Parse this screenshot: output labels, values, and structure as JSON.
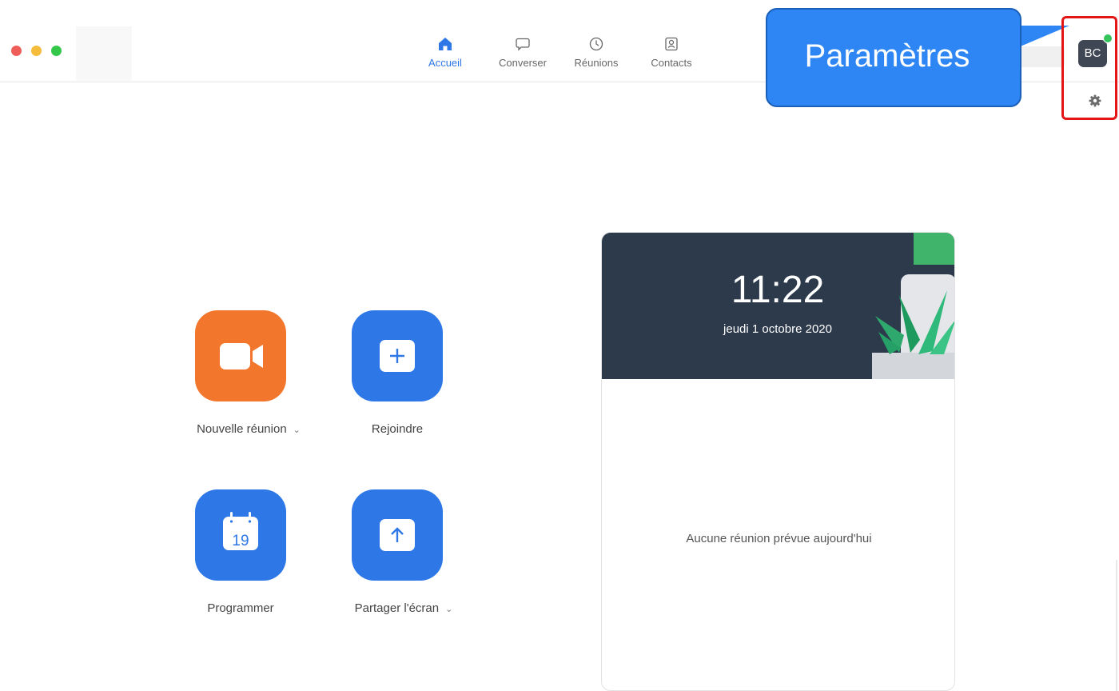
{
  "nav": {
    "tabs": [
      {
        "label": "Accueil",
        "icon": "home-icon",
        "active": true
      },
      {
        "label": "Converser",
        "icon": "chat-icon",
        "active": false
      },
      {
        "label": "Réunions",
        "icon": "clock-icon",
        "active": false
      },
      {
        "label": "Contacts",
        "icon": "contacts-icon",
        "active": false
      }
    ]
  },
  "callout": {
    "text": "Paramètres"
  },
  "profile": {
    "initials": "BC",
    "status_color": "#35c35b"
  },
  "actions": [
    {
      "label": "Nouvelle réunion",
      "icon": "video-camera-icon",
      "color": "#f2762c",
      "has_dropdown": true
    },
    {
      "label": "Rejoindre",
      "icon": "plus-icon",
      "color": "#2d77e6",
      "has_dropdown": false
    },
    {
      "label": "Programmer",
      "icon": "calendar-icon",
      "color": "#2d77e6",
      "has_dropdown": false,
      "day": "19"
    },
    {
      "label": "Partager l'écran",
      "icon": "share-screen-icon",
      "color": "#2d77e6",
      "has_dropdown": true
    }
  ],
  "calendar": {
    "time": "11:22",
    "date": "jeudi 1 octobre 2020",
    "empty_message": "Aucune réunion prévue aujourd'hui"
  },
  "colors": {
    "accent": "#2d77e6",
    "highlight": "#e31515",
    "callout": "#2e86f5"
  }
}
